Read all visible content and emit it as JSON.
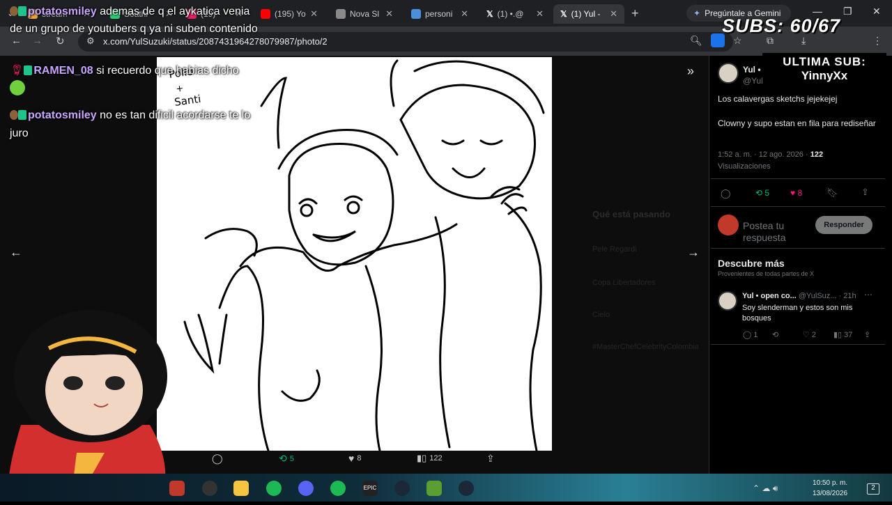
{
  "browser": {
    "tabs": [
      {
        "label": "stream",
        "color": "#e8a33a"
      },
      {
        "label": "Soathi",
        "color": "#2ecc71"
      },
      {
        "label": "(19)",
        "color": "#e91e63"
      },
      {
        "label": "(195) Yo",
        "color": "#ff0000"
      },
      {
        "label": "Nova Sl",
        "color": "#8a8a8a"
      },
      {
        "label": "personi",
        "color": "#4a90d9"
      },
      {
        "label": "(1) •.@",
        "color": "#ffffff"
      },
      {
        "label": "(1) Yul -",
        "color": "#ffffff"
      }
    ],
    "new_tab": "+",
    "gemini_label": "Pregúntale a Gemini",
    "url": "x.com/YulSuzuki/status/2087431964278079987/photo/2",
    "accent": "#8ab4f8"
  },
  "chat": [
    {
      "user": "potatosmiley",
      "text": "ademas de q el aykatica venia de un grupo de youtubers q ya ni suben contenido"
    },
    {
      "user": "RAMEN_08",
      "text": "si recuerdo que habias dicho"
    },
    {
      "user": "potatosmiley",
      "text": "no es tan dificil acordarse te lo juro"
    }
  ],
  "overlay": {
    "subs_label": "SUBS: 60/67",
    "last_sub_title": "ULTIMA SUB:",
    "last_sub_name": "YinnyXx",
    "signature": "Pollo + Santi"
  },
  "post": {
    "author": "Yul •",
    "handle": "@Yul",
    "text_line1": "Los calavergas sketchs jejekejej",
    "text_line2": "Clowny y supo estan en fila para rediseñar",
    "timestamp": "1:52 a. m. · 12 ago. 2026 ·",
    "views": "122",
    "views_label": "Visualizaciones",
    "reposts": "5",
    "likes": "8",
    "reply_placeholder": "Postea tu respuesta",
    "reply_button": "Responder"
  },
  "discover": {
    "title": "Descubre más",
    "subtitle": "Provenientes de todas partes de X",
    "item_author": "Yul • open co...",
    "item_handle": "@YulSuz...",
    "item_time": "· 21h",
    "item_text": "Soy slenderman y estos son mis bosques",
    "item_replies": "1",
    "item_likes": "2",
    "item_views": "37"
  },
  "bottom_bar": {
    "replies": "",
    "reposts": "5",
    "likes": "8",
    "views": "122"
  },
  "background_x": {
    "trending_title": "Qué está pasando",
    "items": [
      "Pele Regardi",
      "Copa Libertadores",
      "Cielo",
      "#MasterChefCelebrityColombia"
    ]
  },
  "taskbar": {
    "time": "10:50 p. m.",
    "date": "13/08/2026",
    "notif_count": "2"
  }
}
